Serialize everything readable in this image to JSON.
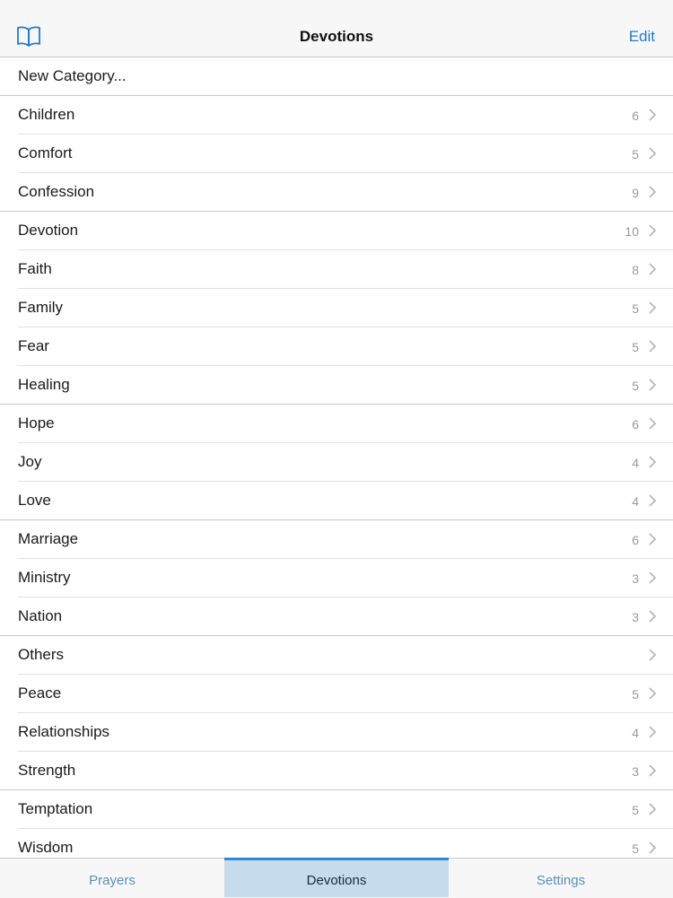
{
  "navbar": {
    "title": "Devotions",
    "edit_label": "Edit",
    "left_icon": "book-icon"
  },
  "new_category_label": "New Category...",
  "categories": [
    {
      "label": "Children",
      "count": "6"
    },
    {
      "label": "Comfort",
      "count": "5"
    },
    {
      "label": "Confession",
      "count": "9"
    },
    {
      "label": "Devotion",
      "count": "10"
    },
    {
      "label": "Faith",
      "count": "8"
    },
    {
      "label": "Family",
      "count": "5"
    },
    {
      "label": "Fear",
      "count": "5"
    },
    {
      "label": "Healing",
      "count": "5"
    },
    {
      "label": "Hope",
      "count": "6"
    },
    {
      "label": "Joy",
      "count": "4"
    },
    {
      "label": "Love",
      "count": "4"
    },
    {
      "label": "Marriage",
      "count": "6"
    },
    {
      "label": "Ministry",
      "count": "3"
    },
    {
      "label": "Nation",
      "count": "3"
    },
    {
      "label": "Others",
      "count": ""
    },
    {
      "label": "Peace",
      "count": "5"
    },
    {
      "label": "Relationships",
      "count": "4"
    },
    {
      "label": "Strength",
      "count": "3"
    },
    {
      "label": "Temptation",
      "count": "5"
    },
    {
      "label": "Wisdom",
      "count": "5"
    }
  ],
  "tabs": [
    {
      "label": "Prayers",
      "active": false
    },
    {
      "label": "Devotions",
      "active": true
    },
    {
      "label": "Settings",
      "active": false
    }
  ],
  "colors": {
    "accent": "#1f7bd1",
    "active_tab_bg": "#c6dced",
    "active_tab_border": "#2c8ad4"
  }
}
